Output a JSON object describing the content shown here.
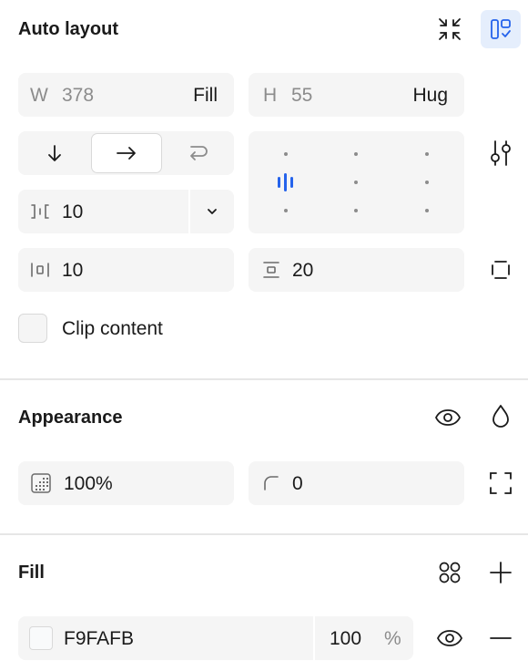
{
  "auto_layout": {
    "title": "Auto layout",
    "width": {
      "prefix": "W",
      "value": "378",
      "mode": "Fill"
    },
    "height": {
      "prefix": "H",
      "value": "55",
      "mode": "Hug"
    },
    "gap": {
      "value": "10"
    },
    "horizontal_padding": {
      "value": "10"
    },
    "vertical_padding": {
      "value": "20"
    },
    "clip_content": {
      "label": "Clip content",
      "checked": false
    },
    "direction_selected": "horizontal"
  },
  "appearance": {
    "title": "Appearance",
    "opacity": "100%",
    "corner_radius": "0"
  },
  "fill": {
    "title": "Fill",
    "hex": "F9FAFB",
    "opacity": "100",
    "unit": "%",
    "swatch_color": "#F9FAFB"
  },
  "colors": {
    "accent": "#2563eb",
    "active_bg": "#e5eefc"
  }
}
